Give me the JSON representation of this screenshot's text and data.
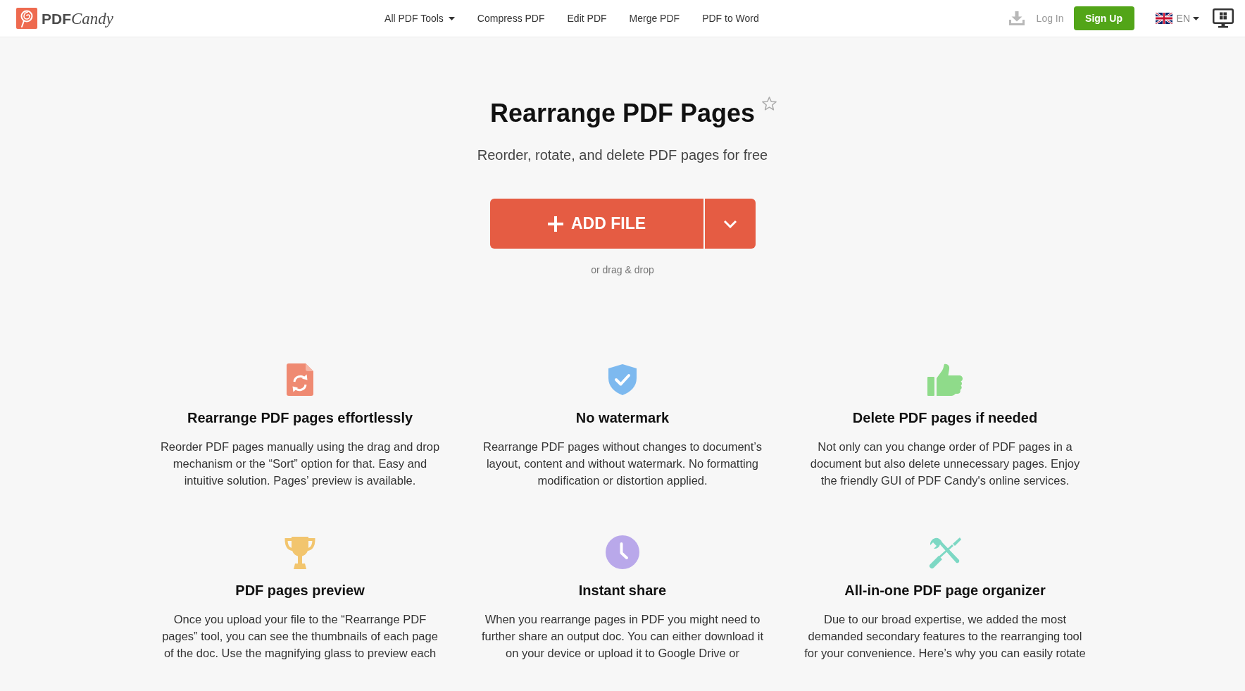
{
  "header": {
    "logo": {
      "bold_part": "PDF",
      "script_part": "Candy"
    },
    "nav": [
      {
        "label": "All PDF Tools",
        "kind": "dropdown"
      },
      {
        "label": "Compress PDF",
        "kind": "link"
      },
      {
        "label": "Edit PDF",
        "kind": "link"
      },
      {
        "label": "Merge PDF",
        "kind": "link"
      },
      {
        "label": "PDF to Word",
        "kind": "link"
      }
    ],
    "login": "Log In",
    "signup": "Sign Up",
    "language": "EN"
  },
  "hero": {
    "title": "Rearrange PDF Pages",
    "subtitle": "Reorder, rotate, and delete PDF pages for free",
    "add_button": "ADD FILE",
    "drop_hint": "or drag & drop"
  },
  "features": [
    {
      "title": "Rearrange PDF pages effortlessly",
      "text": "Reorder PDF pages manually using the drag and drop mechanism or the “Sort” option for that. Easy and intuitive solution. Pages’ preview is available."
    },
    {
      "title": "No watermark",
      "text": "Rearrange PDF pages without changes to document’s layout, content and without watermark. No formatting modification or distortion applied."
    },
    {
      "title": "Delete PDF pages if needed",
      "text": "Not only can you change order of PDF pages in a document but also delete unnecessary pages. Enjoy the friendly GUI of PDF Candy's online services."
    },
    {
      "title": "PDF pages preview",
      "text": "Once you upload your file to the “Rearrange PDF pages” tool, you can see the thumbnails of each page of the doc. Use the magnifying glass to preview each"
    },
    {
      "title": "Instant share",
      "text": "When you rearrange pages in PDF you might need to further share an output doc. You can either download it on your device or upload it to Google Drive or"
    },
    {
      "title": "All-in-one PDF page organizer",
      "text": "Due to our broad expertise, we added the most demanded secondary features to the rearranging tool for your convenience. Here’s why you can easily rotate"
    }
  ]
}
